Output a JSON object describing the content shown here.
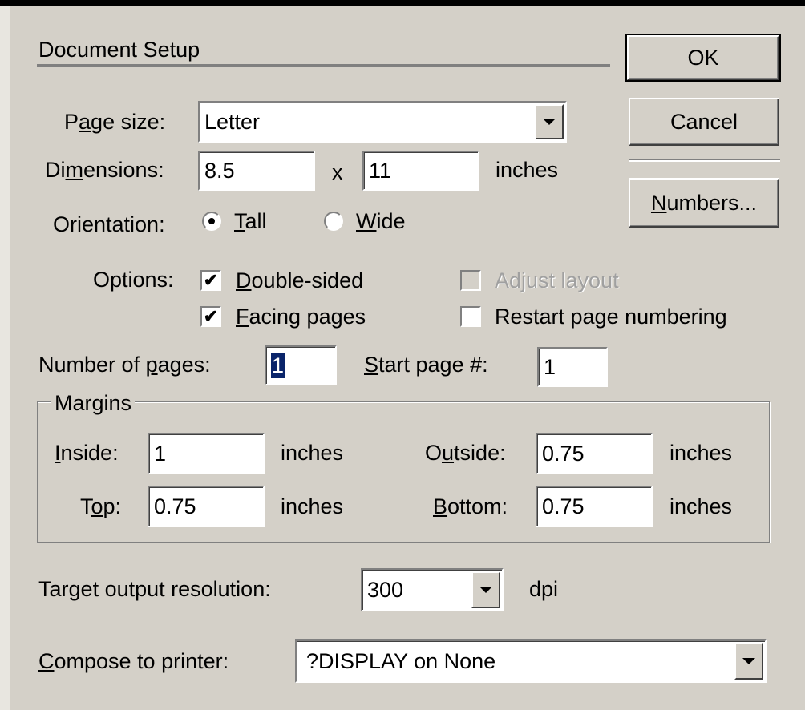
{
  "dialog": {
    "title": "Document Setup",
    "ok_label": "OK",
    "cancel_label": "Cancel",
    "numbers_label": "Numbers..."
  },
  "page_size": {
    "label": "Page size:",
    "value": "Letter"
  },
  "dimensions": {
    "label": "Dimensions:",
    "width": "8.5",
    "times": "x",
    "height": "11",
    "unit": "inches"
  },
  "orientation": {
    "label": "Orientation:",
    "tall": "Tall",
    "wide": "Wide",
    "selected": "Tall"
  },
  "options": {
    "label": "Options:",
    "double_sided": "Double-sided",
    "double_sided_checked": true,
    "facing_pages": "Facing pages",
    "facing_pages_checked": true,
    "adjust_layout": "Adjust layout",
    "adjust_layout_checked": false,
    "restart_numbering": "Restart page numbering",
    "restart_numbering_checked": false
  },
  "pages": {
    "number_label": "Number of pages:",
    "number_value": "1",
    "start_label": "Start page #:",
    "start_value": "1"
  },
  "margins": {
    "group_label": "Margins",
    "inside_label": "Inside:",
    "inside_value": "1",
    "outside_label": "Outside:",
    "outside_value": "0.75",
    "top_label": "Top:",
    "top_value": "0.75",
    "bottom_label": "Bottom:",
    "bottom_value": "0.75",
    "unit": "inches"
  },
  "resolution": {
    "label": "Target output resolution:",
    "value": "300",
    "unit": "dpi"
  },
  "printer": {
    "label": "Compose to printer:",
    "value": "?DISPLAY on None"
  }
}
